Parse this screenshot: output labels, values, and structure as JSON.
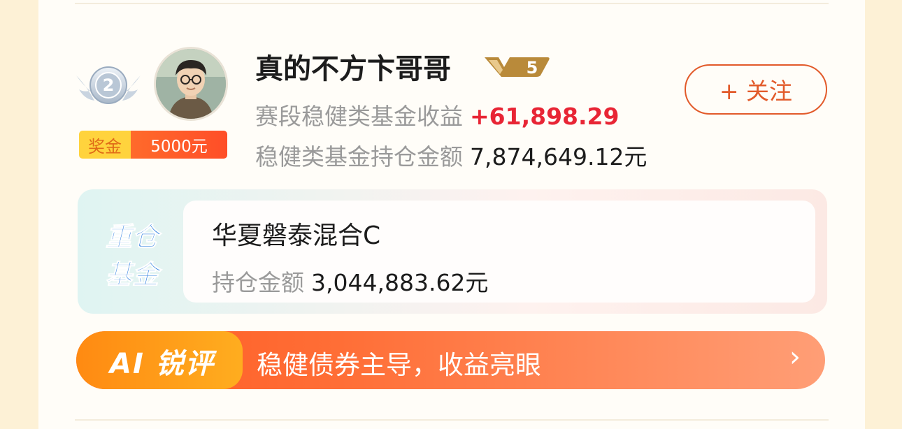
{
  "user": {
    "rank": "2",
    "name": "真的不方卞哥哥",
    "level": "5",
    "prize_label": "奖金",
    "prize_value": "5000元",
    "follow_label": "+ 关注"
  },
  "stats": {
    "income_label": "赛段稳健类基金收益",
    "income_value": "+61,898.29",
    "holding_label": "稳健类基金持仓金额",
    "holding_value": "7,874,649.12元"
  },
  "fund": {
    "badge_line1": "重仓",
    "badge_line2": "基金",
    "name": "华夏磐泰混合C",
    "amount_label": "持仓金额",
    "amount_value": "3,044,883.62元"
  },
  "ai": {
    "badge": "AI 锐评",
    "comment": "稳健债券主导，收益亮眼",
    "arrow": "›"
  },
  "colors": {
    "accent": "#e25a2a",
    "gain": "#e82535",
    "prize_gold": "#ffd33d",
    "fund_blue": "#2e7fe0"
  },
  "icons": [
    "rank-medal-icon",
    "avatar",
    "level-badge-icon",
    "chevron-right-icon"
  ]
}
